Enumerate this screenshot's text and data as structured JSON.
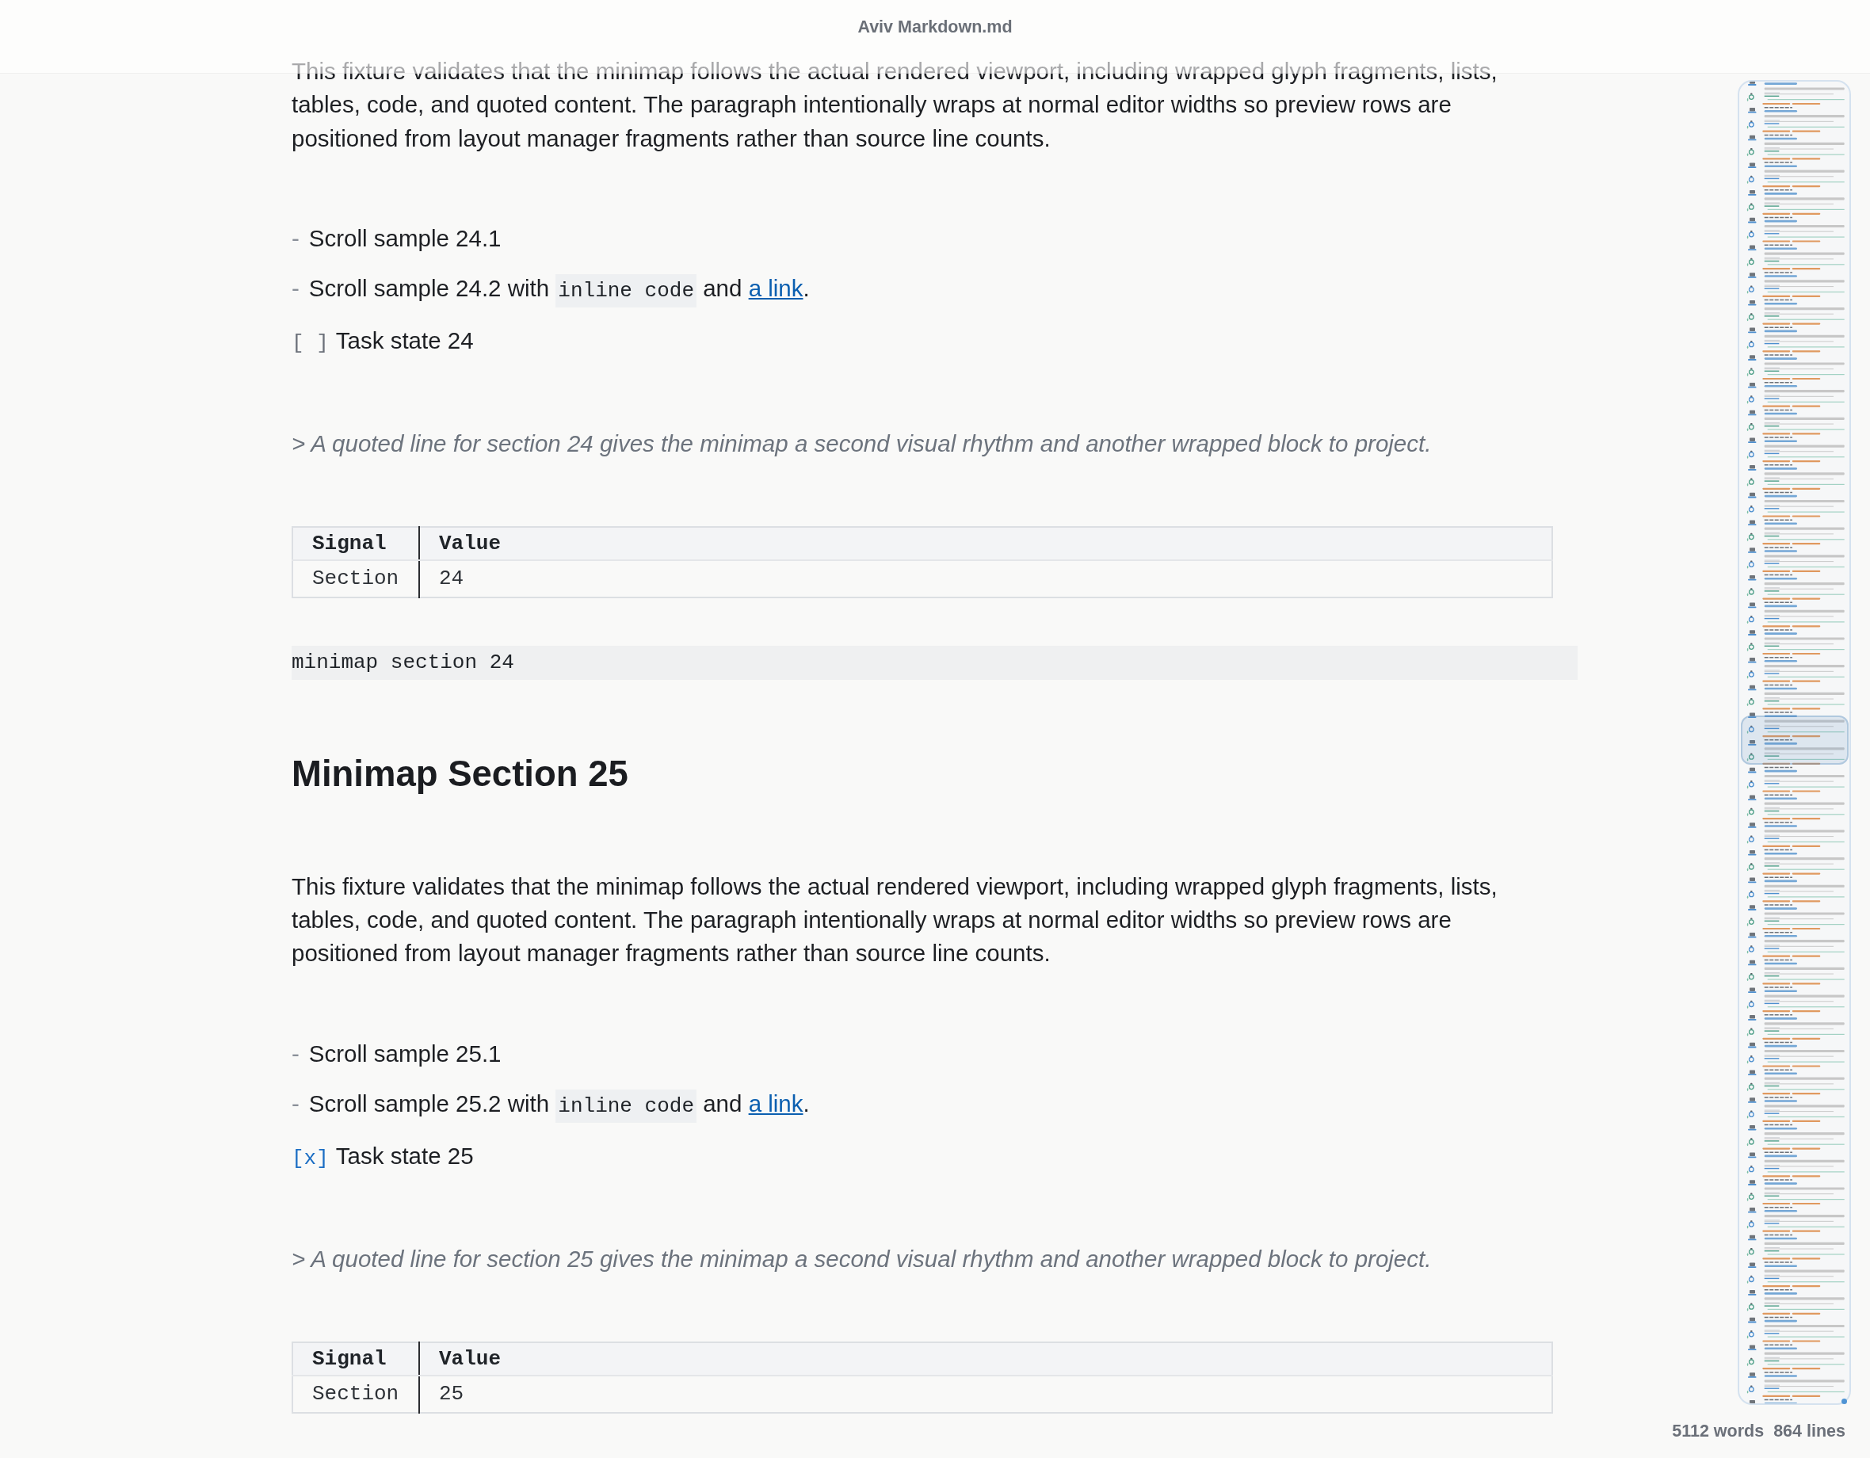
{
  "window": {
    "title": "Aviv Markdown.md"
  },
  "document": {
    "blocks": [
      {
        "kind": "paragraph",
        "text": "This fixture validates that the minimap follows the actual rendered viewport, including wrapped glyph fragments, lists, tables, code, and quoted content. The paragraph intentionally wraps at normal editor widths so preview rows are positioned from layout manager fragments rather than source line counts."
      },
      {
        "kind": "list",
        "items": [
          {
            "kind": "bullet",
            "marker": "-",
            "parts": [
              {
                "kind": "text",
                "text": "Scroll sample 24.1"
              }
            ]
          },
          {
            "kind": "bullet",
            "marker": "-",
            "parts": [
              {
                "kind": "text",
                "text": "Scroll sample 24.2 with "
              },
              {
                "kind": "code",
                "text": "inline code"
              },
              {
                "kind": "text",
                "text": " and "
              },
              {
                "kind": "link",
                "text": "a link"
              },
              {
                "kind": "text",
                "text": "."
              }
            ]
          },
          {
            "kind": "task",
            "marker": "[ ]",
            "checked": false,
            "parts": [
              {
                "kind": "text",
                "text": "Task state 24"
              }
            ]
          }
        ]
      },
      {
        "kind": "quote",
        "text": "> A quoted line for section 24 gives the minimap a second visual rhythm and another wrapped block to project."
      },
      {
        "kind": "table",
        "columns": [
          "Signal",
          "Value"
        ],
        "rows": [
          [
            "Section",
            "24"
          ]
        ]
      },
      {
        "kind": "code",
        "text": "minimap section 24"
      },
      {
        "kind": "heading",
        "text": "Minimap Section 25"
      },
      {
        "kind": "paragraph",
        "text": "This fixture validates that the minimap follows the actual rendered viewport, including wrapped glyph fragments, lists, tables, code, and quoted content. The paragraph intentionally wraps at normal editor widths so preview rows are positioned from layout manager fragments rather than source line counts."
      },
      {
        "kind": "list",
        "items": [
          {
            "kind": "bullet",
            "marker": "-",
            "parts": [
              {
                "kind": "text",
                "text": "Scroll sample 25.1"
              }
            ]
          },
          {
            "kind": "bullet",
            "marker": "-",
            "parts": [
              {
                "kind": "text",
                "text": "Scroll sample 25.2 with "
              },
              {
                "kind": "code",
                "text": "inline code"
              },
              {
                "kind": "text",
                "text": " and "
              },
              {
                "kind": "link",
                "text": "a link"
              },
              {
                "kind": "text",
                "text": "."
              }
            ]
          },
          {
            "kind": "task",
            "marker": "[x]",
            "checked": true,
            "parts": [
              {
                "kind": "text",
                "text": "Task state 25"
              }
            ]
          }
        ]
      },
      {
        "kind": "quote",
        "text": "> A quoted line for section 25 gives the minimap a second visual rhythm and another wrapped block to project."
      },
      {
        "kind": "table",
        "columns": [
          "Signal",
          "Value"
        ],
        "rows": [
          [
            "Section",
            "25"
          ]
        ]
      }
    ]
  },
  "status_bar": {
    "words": "5112 words",
    "lines": "864 lines"
  }
}
